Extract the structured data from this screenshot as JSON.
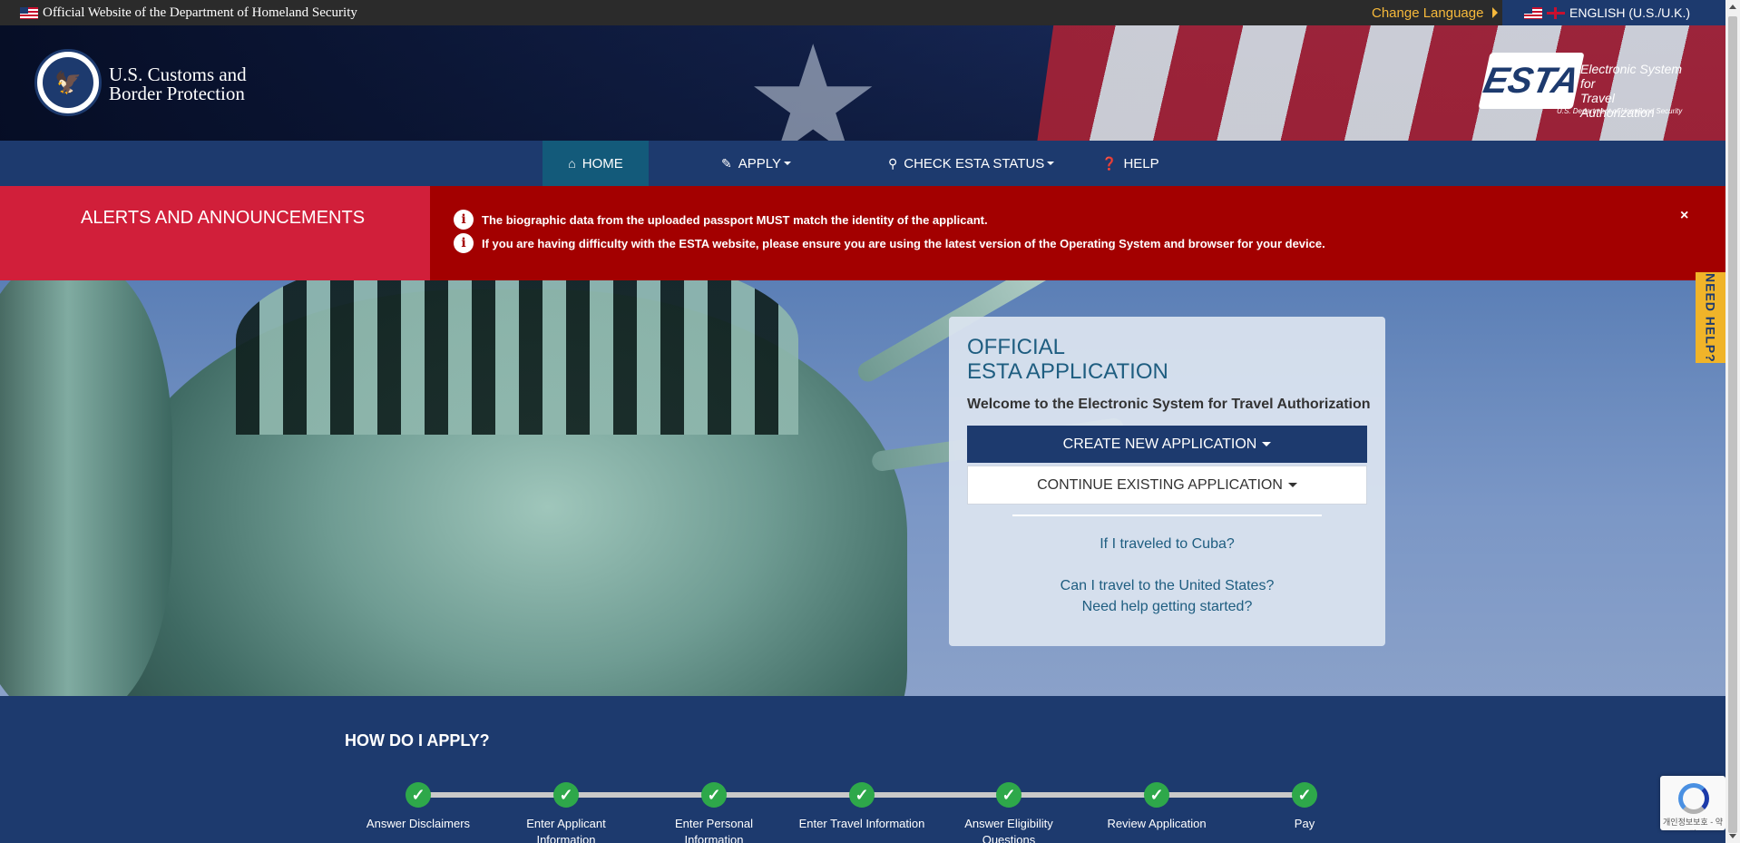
{
  "topbar": {
    "official_text": "Official Website of the Department of Homeland Security",
    "change_language": "Change Language",
    "current_language": "ENGLISH (U.S./U.K.)"
  },
  "header": {
    "agency_line1": "U.S. Customs and",
    "agency_line2": "Border Protection",
    "esta_logo_text": "ESTA",
    "esta_line1": "Electronic System for",
    "esta_line2": "Travel Authorization",
    "esta_sub": "U.S. Department of Homeland Security"
  },
  "nav": {
    "home": "HOME",
    "apply": "APPLY",
    "check_status": "CHECK ESTA STATUS",
    "help": "HELP"
  },
  "alerts": {
    "title": "ALERTS AND ANNOUNCEMENTS",
    "messages": [
      "The biographic data from the uploaded passport MUST match the identity of the applicant.",
      "If you are having difficulty with the ESTA website, please ensure you are using the latest version of the Operating System and browser for your device."
    ],
    "close_symbol": "×"
  },
  "card": {
    "title_line1": "OFFICIAL",
    "title_line2": "ESTA APPLICATION",
    "welcome": "Welcome to the Electronic System for Travel Authorization",
    "create_button": "CREATE NEW APPLICATION",
    "continue_button": "CONTINUE EXISTING APPLICATION",
    "links": [
      "If I traveled to Cuba?",
      "Can I travel to the United States?",
      "Need help getting started?"
    ]
  },
  "how_to_apply": {
    "heading": "HOW DO I APPLY?",
    "steps": [
      "Answer Disclaimers",
      "Enter Applicant Information",
      "Enter Personal Information",
      "Enter Travel Information",
      "Answer Eligibility Questions",
      "Review Application",
      "Pay"
    ]
  },
  "side_tab": {
    "label": "NEED HELP?"
  },
  "recaptcha": {
    "text": "개인정보보호 - 약관"
  },
  "colors": {
    "navy": "#1d3a6e",
    "alert_red": "#a30000",
    "alert_title_red": "#d11f3a",
    "link_blue": "#1e5d80",
    "success_green": "#2ea84a",
    "accent_gold": "#f0b429"
  }
}
